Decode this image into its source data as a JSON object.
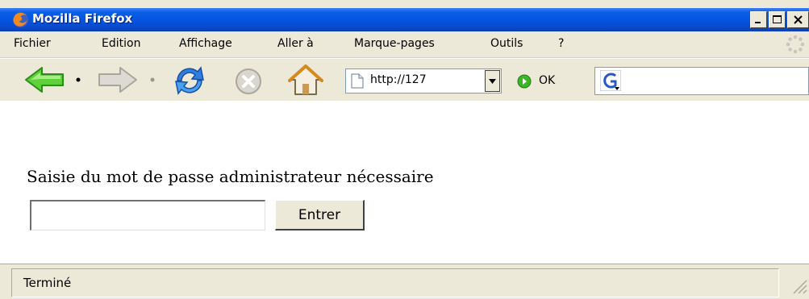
{
  "window": {
    "title": "Mozilla Firefox",
    "title_bar_color": "#0454e0"
  },
  "menu": {
    "items": [
      "Fichier",
      "Edition",
      "Affichage",
      "Aller à",
      "Marque-pages",
      "Outils",
      "?"
    ]
  },
  "toolbar": {
    "back_icon": "back-arrow-icon",
    "forward_icon": "forward-arrow-icon",
    "reload_icon": "reload-icon",
    "stop_icon": "stop-icon",
    "home_icon": "home-icon",
    "url": "http://127",
    "go_label": "OK",
    "search_engine_icon": "google-icon",
    "search_value": ""
  },
  "content": {
    "prompt": "Saisie du mot de passe administrateur nécessaire",
    "password_value": "",
    "submit_label": "Entrer"
  },
  "status": {
    "text": "Terminé"
  }
}
